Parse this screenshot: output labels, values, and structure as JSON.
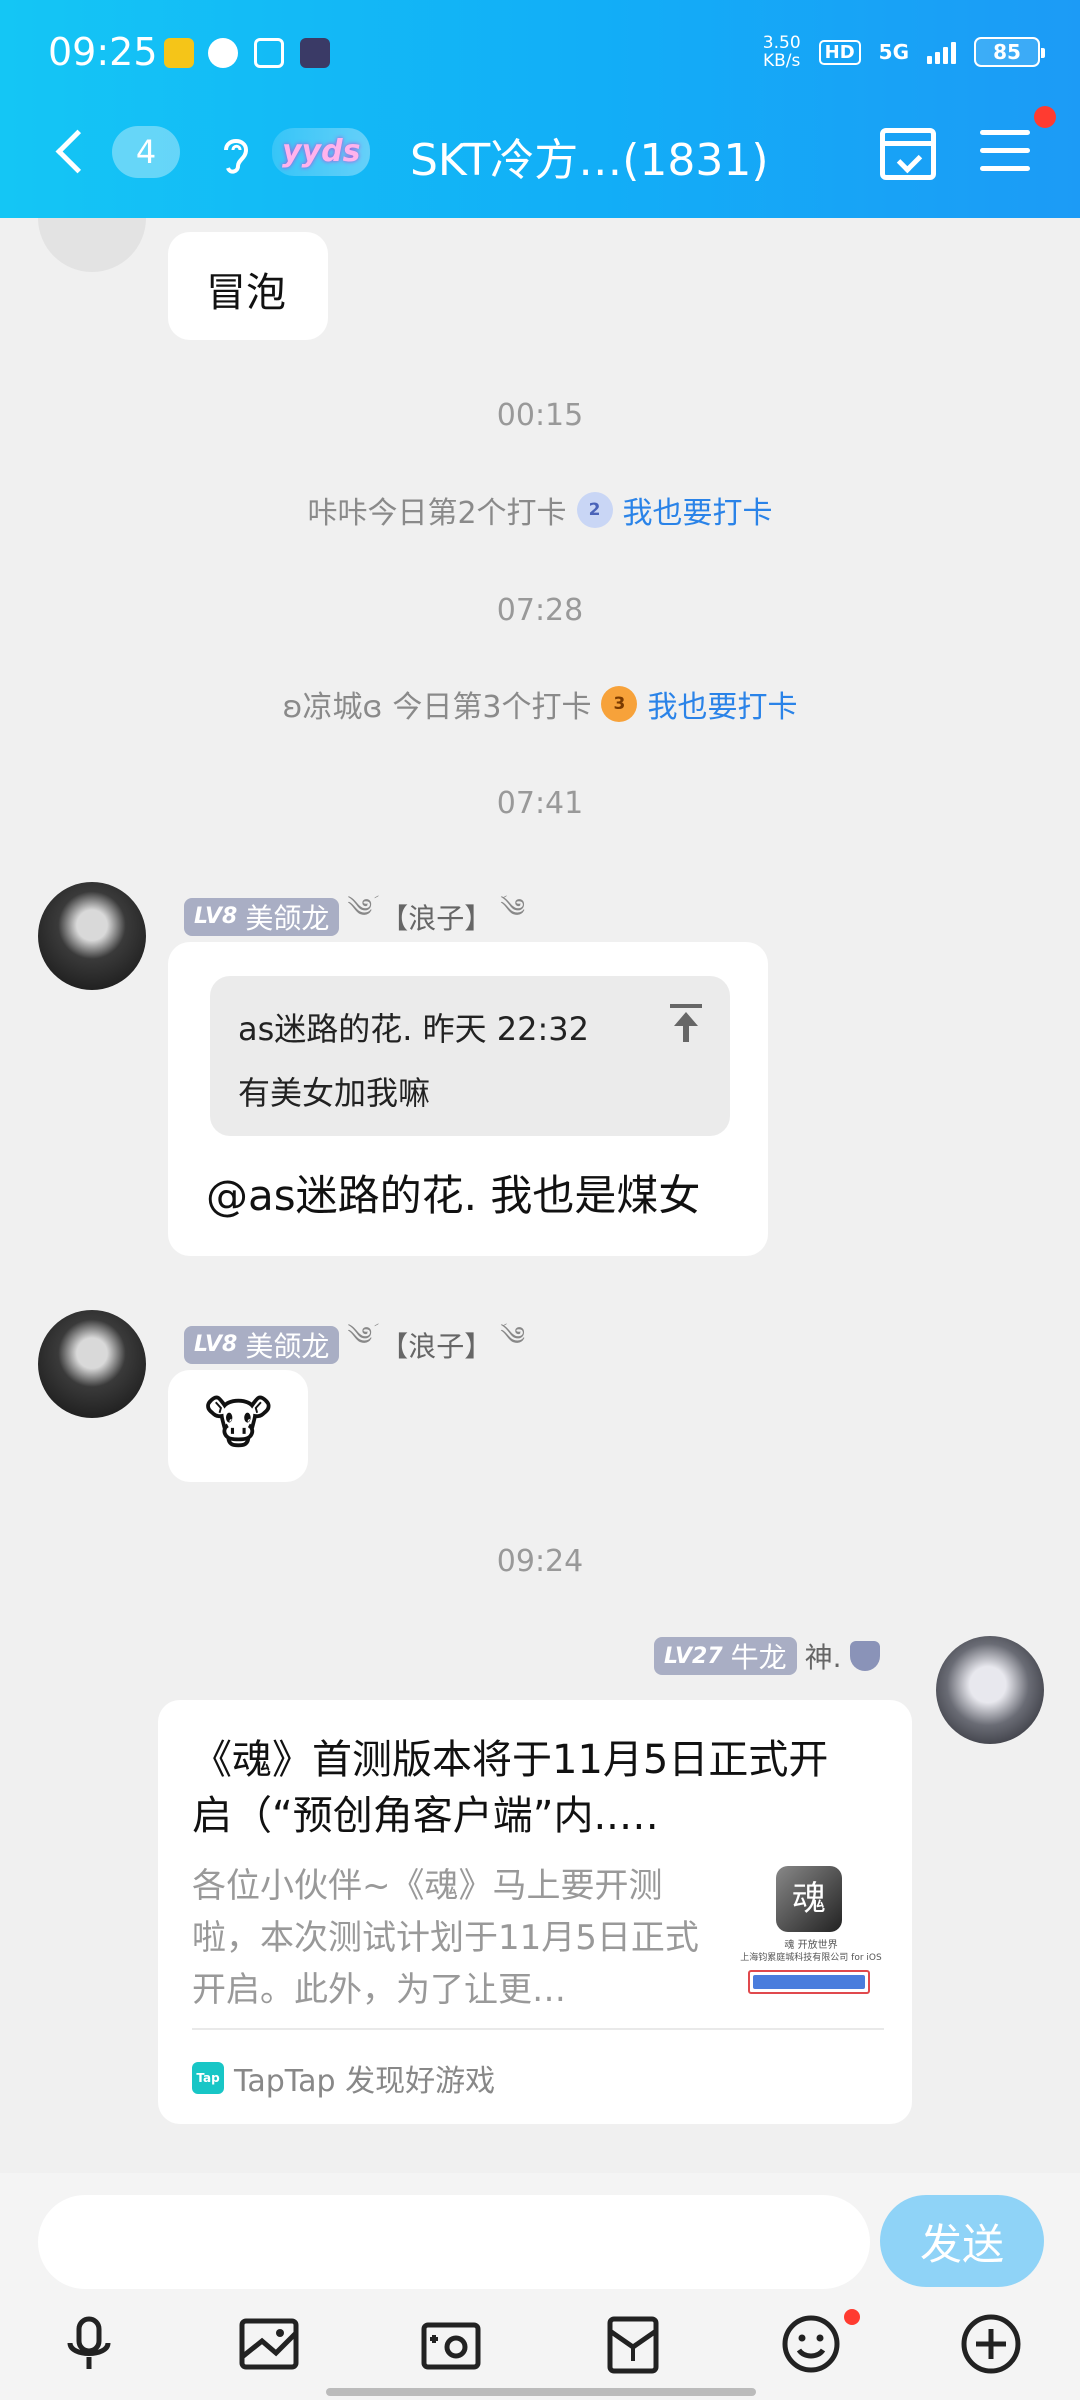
{
  "status_bar": {
    "time": "09:25",
    "speed_value": "3.50",
    "speed_unit": "KB/s",
    "hd": "HD",
    "network": "5G",
    "battery": "85"
  },
  "header": {
    "unread_count": "4",
    "group_badge": "yyds",
    "title": "SKT冷方…(1831)"
  },
  "messages": {
    "m1_text": "冒泡",
    "time1": "00:15",
    "checkin1_user_text": "咔咔今日第2个打卡",
    "checkin1_badge": "2",
    "checkin_link": "我也要打卡",
    "time2": "07:28",
    "checkin2_user_text": "凉城",
    "checkin2_rest": "今日第3个打卡",
    "checkin2_badge": "3",
    "time3": "07:41",
    "sender1": {
      "level": "LV8",
      "name": "美颌龙",
      "tag": "【浪子】"
    },
    "quote_header": "as迷路的花. 昨天 22:32",
    "quote_text": "有美女加我嘛",
    "m2_text": "@as迷路的花. 我也是煤女",
    "m3_emoji": "🐮",
    "time4": "09:24",
    "sender2": {
      "level": "LV27",
      "name": "牛龙",
      "tag": "神."
    },
    "card": {
      "title": "《魂》首测版本将于11月5日正式开启（“预创角客户端”内..…",
      "desc": "各位小伙伴~《魂》马上要开测啦，本次测试计划于11月5日正式开启。此外，为了让更…",
      "thumb_logo": "魂",
      "thumb_line1": "魂 开放世界",
      "thumb_line2": "上海钧累庭城科技有限公司 for iOS",
      "source": "TapTap 发现好游戏",
      "source_icon": "Tap"
    }
  },
  "input": {
    "placeholder": "",
    "send_label": "发送"
  },
  "icons": {
    "mic": "microphone-icon",
    "image": "image-icon",
    "camera": "camera-icon",
    "gift": "red-packet-icon",
    "emoji": "emoji-icon",
    "plus": "plus-icon"
  },
  "colors": {
    "header_start": "#14c6f5",
    "header_end": "#1c9bf6",
    "link": "#2a83e8",
    "send_button": "#8fd3f7",
    "badge_red": "#ff3b30"
  }
}
